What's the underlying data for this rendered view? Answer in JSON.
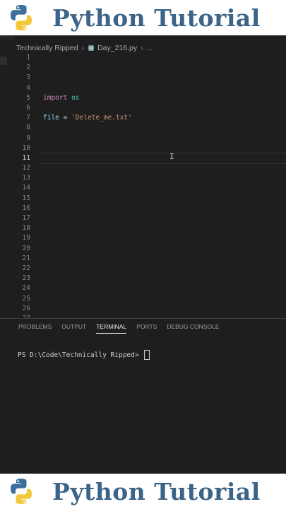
{
  "banner": {
    "title": "Python Tutorial",
    "logo_icon": "python-logo-icon"
  },
  "breadcrumb": {
    "folder": "Technically Ripped",
    "file": "Day_216.py",
    "more": "..."
  },
  "editor": {
    "line_numbers": [
      "1",
      "2",
      "3",
      "4",
      "5",
      "6",
      "7",
      "8",
      "9",
      "10",
      "11",
      "12",
      "13",
      "14",
      "15",
      "16",
      "17",
      "18",
      "19",
      "20",
      "21",
      "22",
      "23",
      "24",
      "25",
      "26",
      "27"
    ],
    "active_line": "11",
    "code": {
      "line5_keyword": "import",
      "line5_module": "os",
      "line7_var": "file",
      "line7_op": " = ",
      "line7_string": "'Delete_me.txt'"
    }
  },
  "panel": {
    "tabs": [
      "PROBLEMS",
      "OUTPUT",
      "TERMINAL",
      "PORTS",
      "DEBUG CONSOLE"
    ],
    "active_tab": "TERMINAL",
    "prompt": "PS D:\\Code\\Technically Ripped> "
  },
  "colors": {
    "banner_text": "#3b6488",
    "editor_bg": "#1e1e1e",
    "keyword": "#c586c0",
    "string": "#ce9178",
    "variable": "#9cdcfe"
  }
}
